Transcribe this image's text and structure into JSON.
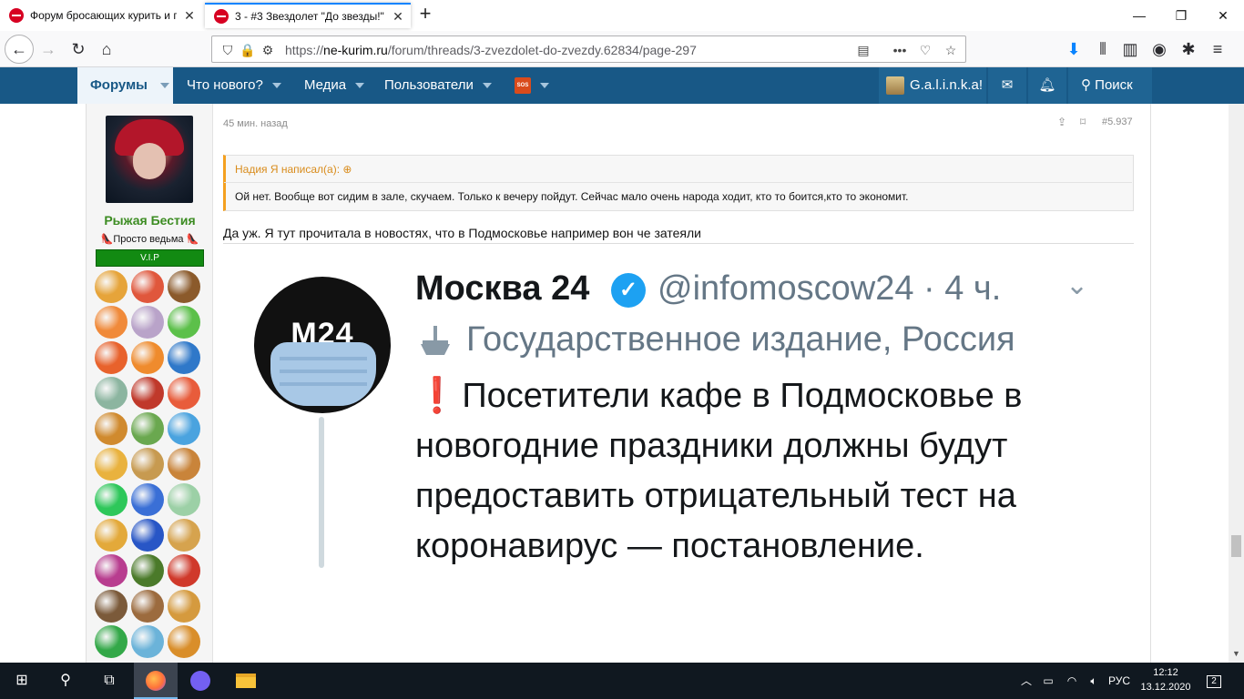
{
  "browser": {
    "tabs": [
      {
        "title": "Форум бросающих курить и п"
      },
      {
        "title": "3 - #3 Звездолет \"До звезды!\" "
      }
    ],
    "url_prefix": "https://",
    "url_domain": "ne-kurim.ru",
    "url_path": "/forum/threads/3-zvezdolet-do-zvezdy.62834/page-297"
  },
  "forum_nav": {
    "forums": "Форумы",
    "whats_new": "Что нового?",
    "media": "Медиа",
    "users": "Пользователи",
    "badge": "SOS",
    "username": "G.a.l.i.n.k.a!",
    "search": "Поиск"
  },
  "author": {
    "name": "Рыжая Бестия",
    "title": "👠Просто ведьма 👠",
    "rank": "V.I.P"
  },
  "post": {
    "time": "45 мин. назад",
    "number": "#5.937",
    "quote_author": "Надия Я написал(а): ⊕",
    "quote_text": "Ой нет. Вообще вот сидим в зале, скучаем. Только к вечеру пойдут. Сейчас мало очень народа ходит, кто то боится,кто то экономит.",
    "text": "Да уж. Я тут прочитала в новостях, что в Подмосковье например вон че затеяли"
  },
  "tweet": {
    "logo_text": "M24",
    "name": "Москва 24",
    "handle": "@infomoscow24 · 4 ч.",
    "label": "Государственное издание, Россия",
    "body": "Посетители кафе в Подмосковье в новогодние праздники должны будут предоставить отрицательный тест на коронавирус — постановление."
  },
  "taskbar": {
    "lang": "РУС",
    "time": "12:12",
    "date": "13.12.2020",
    "notifications": "2"
  },
  "colors": {
    "forum_nav": "#185886",
    "username": "#3c8c22",
    "vip": "#128a12",
    "quote_accent": "#f4a020",
    "verified": "#1da1f2"
  }
}
